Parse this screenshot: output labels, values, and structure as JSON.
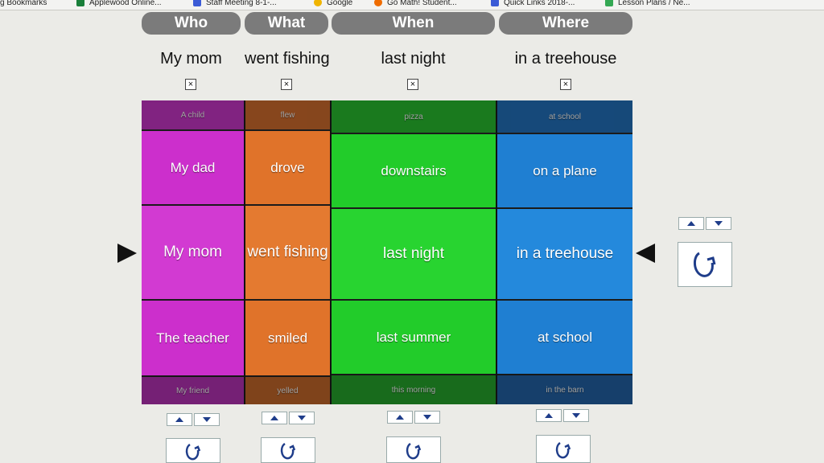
{
  "bookmarks": [
    {
      "label": "g Bookmarks",
      "color": "#555555"
    },
    {
      "label": "Applewood Online...",
      "color": "#1a7f3a"
    },
    {
      "label": "Staff Meeting 8-1-...",
      "color": "#3b5bd6"
    },
    {
      "label": "Google",
      "color": "#f0b400"
    },
    {
      "label": "Go Math! Student...",
      "color": "#ef6c00"
    },
    {
      "label": "Quick Links 2018-...",
      "color": "#3b5bd6"
    },
    {
      "label": "Lesson Plans / Ne...",
      "color": "#34a853"
    }
  ],
  "tabs": {
    "who": "Who",
    "what": "What",
    "when": "When",
    "where": "Where"
  },
  "selection": {
    "who": "My mom",
    "what": "went fishing",
    "when": "last night",
    "where": "in a treehouse",
    "remove_mark": "×"
  },
  "columns": {
    "who": {
      "color": "#cc2fcc",
      "cells": [
        "A child",
        "My dad",
        "My mom",
        "The teacher",
        "My friend"
      ]
    },
    "what": {
      "color": "#e0732a",
      "cells": [
        "flew",
        "drove",
        "went fishing",
        "smiled",
        "yelled"
      ]
    },
    "when": {
      "color": "#22cc2a",
      "cells": [
        "pizza",
        "downstairs",
        "last night",
        "last summer",
        "this morning"
      ]
    },
    "where": {
      "color": "#1f86d6",
      "cells": [
        "at school",
        "on a plane",
        "in a treehouse",
        "at school",
        "in the barn"
      ]
    }
  },
  "icons": {
    "up": "triangle-up-icon",
    "down": "triangle-down-icon",
    "spin": "refresh-icon",
    "pointer_left": "pointer-right-icon",
    "pointer_right": "pointer-left-icon"
  }
}
